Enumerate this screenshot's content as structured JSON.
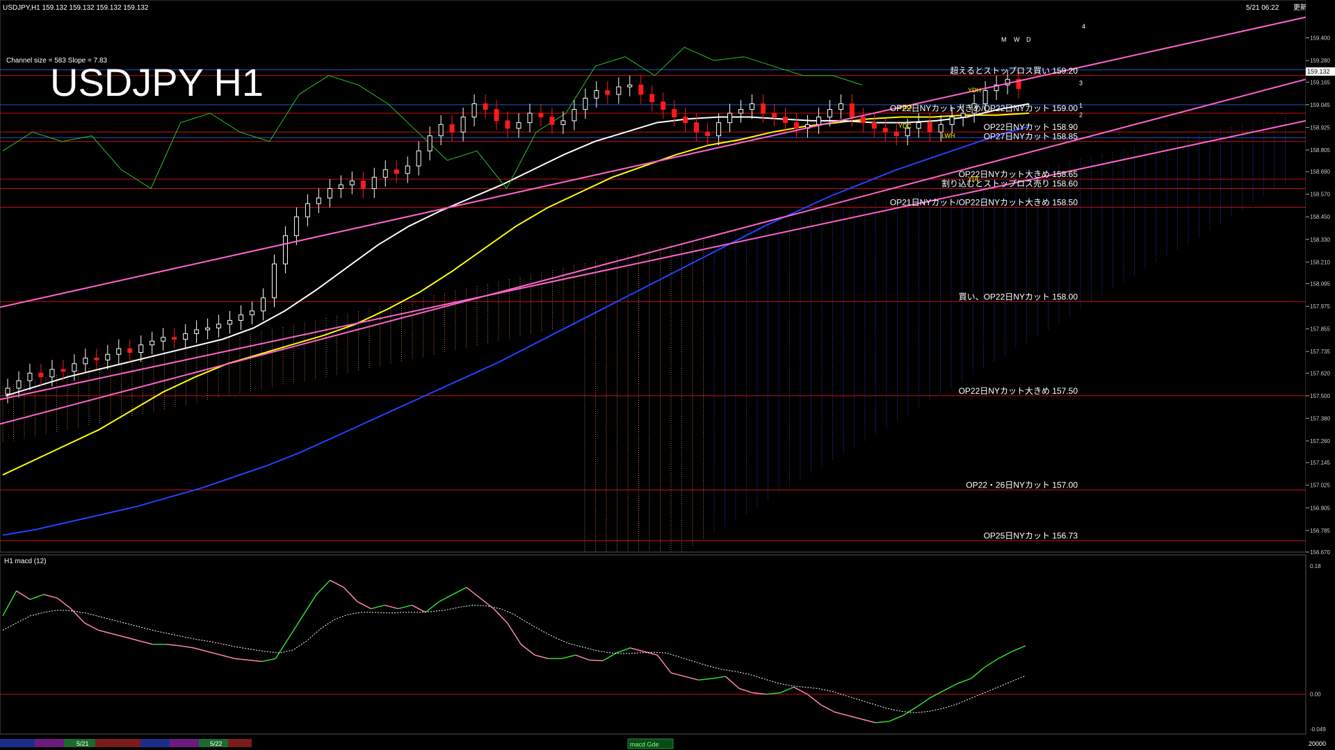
{
  "header": {
    "symbol_info": "USDJPY,H1  159.132 159.132 159.132 159.132",
    "datetime": "5/21 06:22",
    "time_suffix": "更新",
    "channel_info": "Channel size = 583  Slope = 7.83",
    "big_title": "USDJPY H1"
  },
  "colors": {
    "background": "#000000",
    "level_line": "#cc1111",
    "grid_blue": "#2255cc",
    "channel": "#ff66cc",
    "ma_short": "#ffffff",
    "ma_mid": "#ffff00",
    "ma_long": "#2244ff",
    "chikou": "#22cc22",
    "bull_candle": "#ffffff",
    "bear_candle": "#ff1a1a",
    "cloud_bull": "#ff9955",
    "cloud_bear": "#3355ff",
    "macd_up": "#33dd33",
    "macd_down": "#ff88aa"
  },
  "chart_data": [
    {
      "type": "line",
      "ylim": [
        156.67,
        159.52
      ],
      "ticks": [
        "159.400",
        "159.280",
        "159.165",
        "159.045",
        "158.925",
        "158.805",
        "158.690",
        "158.570",
        "158.450",
        "158.330",
        "158.210",
        "158.095",
        "157.975",
        "157.855",
        "157.735",
        "157.620",
        "157.500",
        "157.380",
        "157.260",
        "157.145",
        "157.025",
        "156.905",
        "156.785",
        "156.670"
      ],
      "current_price_label": "159.132",
      "levels": [
        {
          "label": "超えるとストップロス買い 159.20",
          "value": 159.2
        },
        {
          "label": "OP22日NYカット大きめ/OP22日NYカット 159.00",
          "value": 159.0
        },
        {
          "label": "OP22日NYカット 158.90",
          "value": 158.9
        },
        {
          "label": "OP27日NYカット 158.85",
          "value": 158.85
        },
        {
          "label": "OP22日NYカット大きめ 158.65",
          "value": 158.65
        },
        {
          "label": "割り込むとストップロス売り 158.60",
          "value": 158.6
        },
        {
          "label": "OP21日NYカット/OP22日NYカット大きめ 158.50",
          "value": 158.5
        },
        {
          "label": "買い、OP22日NYカット 158.00",
          "value": 158.0
        },
        {
          "label": "OP22日NYカット大きめ 157.50",
          "value": 157.5
        },
        {
          "label": "OP22・26日NYカット 157.00",
          "value": 157.0
        },
        {
          "label": "OP25日NYカット 156.73",
          "value": 156.73
        }
      ],
      "pivot_labels": [
        "YDH",
        "YDO",
        "YDC",
        "YDL",
        "LWH",
        "M",
        "W",
        "D",
        "1",
        "2",
        "3",
        "4"
      ],
      "candles_close": [
        157.54,
        157.58,
        157.62,
        157.6,
        157.64,
        157.63,
        157.67,
        157.7,
        157.69,
        157.72,
        157.75,
        157.73,
        157.77,
        157.79,
        157.81,
        157.8,
        157.83,
        157.85,
        157.86,
        157.88,
        157.9,
        157.93,
        157.95,
        158.02,
        158.2,
        158.35,
        158.45,
        158.52,
        158.55,
        158.6,
        158.62,
        158.64,
        158.6,
        158.66,
        158.7,
        158.68,
        158.72,
        158.8,
        158.88,
        158.94,
        158.9,
        158.98,
        159.05,
        159.02,
        158.96,
        158.92,
        158.95,
        159.0,
        158.98,
        158.94,
        158.96,
        159.02,
        159.08,
        159.12,
        159.1,
        159.14,
        159.15,
        159.1,
        159.06,
        159.02,
        158.98,
        158.95,
        158.9,
        158.88,
        158.95,
        159.0,
        159.02,
        159.05,
        159.0,
        158.98,
        158.95,
        158.92,
        158.94,
        158.98,
        159.02,
        159.05,
        158.98,
        158.95,
        158.92,
        158.9,
        158.88,
        158.92,
        158.95,
        158.9,
        158.94,
        158.98,
        159.0,
        159.05,
        159.12,
        159.15,
        159.18,
        159.13
      ],
      "ma_short": [
        157.5,
        157.55,
        157.6,
        157.64,
        157.68,
        157.72,
        157.76,
        157.8,
        157.86,
        157.95,
        158.06,
        158.18,
        158.3,
        158.4,
        158.48,
        158.55,
        158.62,
        158.7,
        158.78,
        158.85,
        158.9,
        158.95,
        158.97,
        158.98,
        158.98,
        158.97,
        158.96,
        158.96,
        158.95,
        158.95,
        158.96,
        158.98,
        159.02,
        159.05
      ],
      "ma_mid": [
        157.08,
        157.16,
        157.24,
        157.32,
        157.42,
        157.52,
        157.6,
        157.67,
        157.72,
        157.77,
        157.82,
        157.88,
        157.96,
        158.05,
        158.16,
        158.28,
        158.4,
        158.5,
        158.58,
        158.66,
        158.72,
        158.78,
        158.83,
        158.86,
        158.9,
        158.93,
        158.95,
        158.97,
        158.98,
        158.98,
        158.99,
        158.99,
        159.0
      ],
      "ma_long": [
        156.76,
        156.79,
        156.83,
        156.87,
        156.91,
        156.96,
        157.01,
        157.07,
        157.13,
        157.2,
        157.28,
        157.36,
        157.44,
        157.52,
        157.6,
        157.68,
        157.77,
        157.86,
        157.95,
        158.04,
        158.13,
        158.22,
        158.31,
        158.4,
        158.48,
        158.56,
        158.63,
        158.7,
        158.76,
        158.82,
        158.88,
        158.93
      ],
      "channel_upper": [
        157.97,
        159.51
      ],
      "channel_mid": [
        157.35,
        159.18
      ],
      "channel_lower": [
        157.48,
        158.96
      ],
      "ma_period_note": ""
    },
    {
      "type": "line",
      "title": "H1  macd (12)",
      "ylim": [
        -0.049,
        0.18
      ],
      "ticks": [
        "0.18",
        "0.00",
        "-0.049"
      ],
      "macd": [
        0.11,
        0.145,
        0.133,
        0.14,
        0.135,
        0.12,
        0.1,
        0.09,
        0.085,
        0.08,
        0.075,
        0.07,
        0.07,
        0.068,
        0.065,
        0.06,
        0.055,
        0.05,
        0.048,
        0.046,
        0.05,
        0.08,
        0.11,
        0.14,
        0.16,
        0.15,
        0.13,
        0.12,
        0.125,
        0.12,
        0.125,
        0.115,
        0.13,
        0.14,
        0.15,
        0.135,
        0.12,
        0.1,
        0.07,
        0.055,
        0.05,
        0.05,
        0.055,
        0.048,
        0.047,
        0.058,
        0.065,
        0.06,
        0.055,
        0.03,
        0.025,
        0.02,
        0.022,
        0.025,
        0.008,
        0.002,
        0.0,
        0.002,
        0.01,
        0.0,
        -0.015,
        -0.025,
        -0.03,
        -0.035,
        -0.04,
        -0.038,
        -0.03,
        -0.018,
        -0.005,
        0.005,
        0.015,
        0.022,
        0.038,
        0.05,
        0.06,
        0.068
      ],
      "signal": [
        0.09,
        0.1,
        0.11,
        0.115,
        0.118,
        0.117,
        0.114,
        0.109,
        0.104,
        0.099,
        0.094,
        0.089,
        0.085,
        0.081,
        0.077,
        0.074,
        0.07,
        0.066,
        0.063,
        0.06,
        0.058,
        0.062,
        0.075,
        0.092,
        0.105,
        0.112,
        0.115,
        0.115,
        0.114,
        0.115,
        0.115,
        0.116,
        0.118,
        0.122,
        0.125,
        0.124,
        0.12,
        0.112,
        0.1,
        0.089,
        0.079,
        0.071,
        0.066,
        0.061,
        0.058,
        0.057,
        0.058,
        0.059,
        0.058,
        0.052,
        0.046,
        0.04,
        0.035,
        0.032,
        0.028,
        0.022,
        0.016,
        0.012,
        0.01,
        0.008,
        0.004,
        -0.002,
        -0.008,
        -0.014,
        -0.02,
        -0.024,
        -0.026,
        -0.024,
        -0.02,
        -0.014,
        -0.006,
        0.002,
        0.01,
        0.018,
        0.026
      ]
    }
  ],
  "timeline": {
    "date_labels": [
      "5/21",
      "5/22"
    ],
    "footer_label": "macd Gde",
    "footer_value": "20000"
  }
}
